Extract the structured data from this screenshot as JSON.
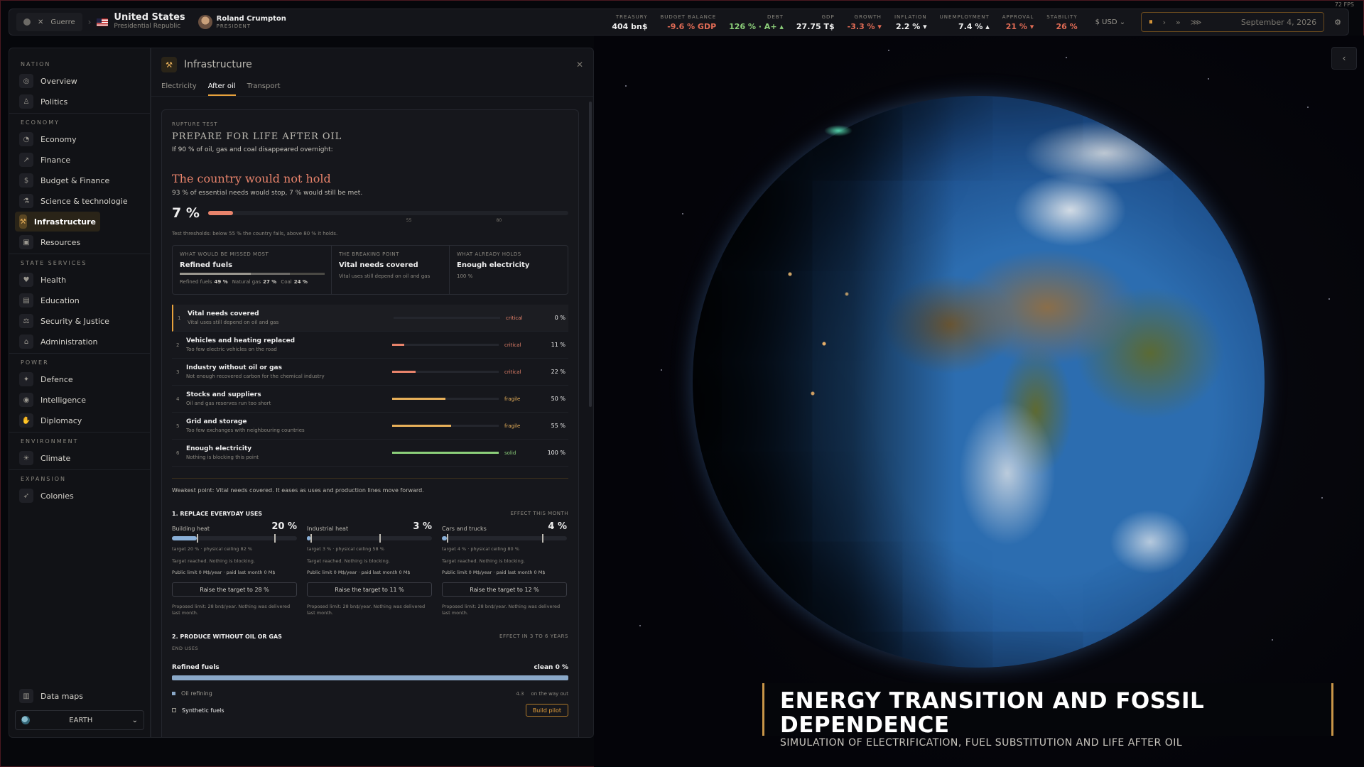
{
  "topbar": {
    "war_label": "Guerre",
    "country": "United States",
    "regime": "Presidential Republic",
    "leader": "Roland Crumpton",
    "leader_role": "PRESIDENT",
    "stats": [
      {
        "label": "TREASURY",
        "value": "404 bn$",
        "tone": ""
      },
      {
        "label": "BUDGET BALANCE",
        "value": "-9.6 % GDP",
        "tone": "neg"
      },
      {
        "label": "DEBT",
        "value": "126 % · A+ ▴",
        "tone": "pos"
      },
      {
        "label": "GDP",
        "value": "27.75 T$",
        "tone": ""
      },
      {
        "label": "GROWTH",
        "value": "-3.3 % ▾",
        "tone": "neg"
      },
      {
        "label": "INFLATION",
        "value": "2.2 % ▾",
        "tone": ""
      },
      {
        "label": "UNEMPLOYMENT",
        "value": "7.4 % ▴",
        "tone": ""
      },
      {
        "label": "APPROVAL",
        "value": "21 % ▾",
        "tone": "neg"
      },
      {
        "label": "STABILITY",
        "value": "26 %",
        "tone": "neg"
      }
    ],
    "currency": "$ USD",
    "date": "September 4, 2026",
    "fps": "72 FPS"
  },
  "sidebar": {
    "sections": [
      {
        "title": "NATION",
        "items": [
          {
            "label": "Overview",
            "icon": "globe-icon",
            "glyph": "◎"
          },
          {
            "label": "Politics",
            "icon": "podium-icon",
            "glyph": "♙"
          }
        ]
      },
      {
        "title": "ECONOMY",
        "items": [
          {
            "label": "Economy",
            "icon": "pie-icon",
            "glyph": "◔"
          },
          {
            "label": "Finance",
            "icon": "chart-icon",
            "glyph": "↗"
          },
          {
            "label": "Budget & Finance",
            "icon": "moneybag-icon",
            "glyph": "$"
          },
          {
            "label": "Science & technologie",
            "icon": "flask-icon",
            "glyph": "⚗"
          },
          {
            "label": "Infrastructure",
            "icon": "crane-icon",
            "glyph": "⚒",
            "active": true
          },
          {
            "label": "Resources",
            "icon": "barrel-icon",
            "glyph": "▣"
          }
        ]
      },
      {
        "title": "STATE SERVICES",
        "items": [
          {
            "label": "Health",
            "icon": "heart-icon",
            "glyph": "♥"
          },
          {
            "label": "Education",
            "icon": "book-icon",
            "glyph": "▤"
          },
          {
            "label": "Security & Justice",
            "icon": "scales-icon",
            "glyph": "⚖"
          },
          {
            "label": "Administration",
            "icon": "building-icon",
            "glyph": "⌂"
          }
        ]
      },
      {
        "title": "POWER",
        "items": [
          {
            "label": "Defence",
            "icon": "tank-icon",
            "glyph": "✦"
          },
          {
            "label": "Intelligence",
            "icon": "spy-icon",
            "glyph": "◉"
          },
          {
            "label": "Diplomacy",
            "icon": "handshake-icon",
            "glyph": "✋"
          }
        ]
      },
      {
        "title": "ENVIRONMENT",
        "items": [
          {
            "label": "Climate",
            "icon": "thermometer-icon",
            "glyph": "☀"
          }
        ]
      },
      {
        "title": "EXPANSION",
        "items": [
          {
            "label": "Colonies",
            "icon": "rocket-icon",
            "glyph": "➶"
          }
        ]
      }
    ],
    "data_maps": "Data maps",
    "planet": "EARTH"
  },
  "panel": {
    "title": "Infrastructure",
    "tabs": [
      {
        "label": "Electricity"
      },
      {
        "label": "After oil",
        "active": true
      },
      {
        "label": "Transport"
      }
    ],
    "kicker": "RUPTURE TEST",
    "heading": "PREPARE FOR LIFE AFTER OIL",
    "intro": "If 90 % of oil, gas and coal disappeared overnight:",
    "verdict": "The country would not hold",
    "verdict_sub": "93 % of essential needs would stop, 7 % would still be met.",
    "score_label": "7 %",
    "score": 7,
    "tick_55": "55",
    "tick_80": "80",
    "thresholds": "Test thresholds: below 55 % the country fails, above 80 % it holds.",
    "summary": {
      "missed_k": "WHAT WOULD BE MISSED MOST",
      "missed_b": "Refined fuels",
      "mix": [
        {
          "label": "Refined fuels",
          "value": "49 %",
          "pct": 49,
          "color": "#9a978f"
        },
        {
          "label": "Natural gas",
          "value": "27 %",
          "pct": 27,
          "color": "#6c6a66"
        },
        {
          "label": "Coal",
          "value": "24 %",
          "pct": 24,
          "color": "#4a4944"
        }
      ],
      "break_k": "THE BREAKING POINT",
      "break_b": "Vital needs covered",
      "break_s": "Vital uses still depend on oil and gas",
      "holds_k": "WHAT ALREADY HOLDS",
      "holds_b": "Enough electricity",
      "holds_s": "100 %"
    },
    "rows": [
      {
        "n": "1",
        "title": "Vital needs covered",
        "desc": "Vital uses still depend on oil and gas",
        "status": "critical",
        "value": "0 %",
        "pct": 0,
        "color": "#e8836b"
      },
      {
        "n": "2",
        "title": "Vehicles and heating replaced",
        "desc": "Too few electric vehicles on the road",
        "status": "critical",
        "value": "11 %",
        "pct": 11,
        "color": "#e8836b"
      },
      {
        "n": "3",
        "title": "Industry without oil or gas",
        "desc": "Not enough recovered carbon for the chemical industry",
        "status": "critical",
        "value": "22 %",
        "pct": 22,
        "color": "#e8836b"
      },
      {
        "n": "4",
        "title": "Stocks and suppliers",
        "desc": "Oil and gas reserves run too short",
        "status": "fragile",
        "value": "50 %",
        "pct": 50,
        "color": "#e8b05a"
      },
      {
        "n": "5",
        "title": "Grid and storage",
        "desc": "Too few exchanges with neighbouring countries",
        "status": "fragile",
        "value": "55 %",
        "pct": 55,
        "color": "#e8b05a"
      },
      {
        "n": "6",
        "title": "Enough electricity",
        "desc": "Nothing is blocking this point",
        "status": "solid",
        "value": "100 %",
        "pct": 100,
        "color": "#8ccf7a"
      }
    ],
    "weakest": "Weakest point: Vital needs covered. It eases as uses and production lines move forward.",
    "s1_title": "1. REPLACE EVERYDAY USES",
    "s1_tag": "EFFECT THIS MONTH",
    "levers": [
      {
        "name": "Building heat",
        "value": "20 %",
        "pct": 20,
        "ceiling": 82,
        "line1": "target 20 % · physical ceiling 82 %",
        "line2": "Target reached. Nothing is blocking.",
        "line3": "Public limit 0 M$/year · paid last month 0 M$",
        "btn": "Raise the target to 28 %",
        "prop": "Proposed limit: 28 bn$/year. Nothing was delivered last month."
      },
      {
        "name": "Industrial heat",
        "value": "3 %",
        "pct": 3,
        "ceiling": 58,
        "line1": "target 3 % · physical ceiling 58 %",
        "line2": "Target reached. Nothing is blocking.",
        "line3": "Public limit 0 M$/year · paid last month 0 M$",
        "btn": "Raise the target to 11 %",
        "prop": "Proposed limit: 28 bn$/year. Nothing was delivered last month."
      },
      {
        "name": "Cars and trucks",
        "value": "4 %",
        "pct": 4,
        "ceiling": 80,
        "line1": "target 4 % · physical ceiling 80 %",
        "line2": "Target reached. Nothing is blocking.",
        "line3": "Public limit 0 M$/year · paid last month 0 M$",
        "btn": "Raise the target to 12 %",
        "prop": "Proposed limit: 28 bn$/year. Nothing was delivered last month."
      }
    ],
    "s2_title": "2. PRODUCE WITHOUT OIL OR GAS",
    "s2_tag": "EFFECT IN 3 TO 6 YEARS",
    "end_uses": "END USES",
    "refined": "Refined fuels",
    "refined_clean": "clean 0 %",
    "oil_refining": "Oil refining",
    "oil_refining_val": "4.3",
    "oil_refining_status": "on the way out",
    "synthetic": "Synthetic fuels",
    "build_pilot": "Build pilot"
  },
  "caption": {
    "title": "ENERGY TRANSITION AND FOSSIL DEPENDENCE",
    "subtitle": "SIMULATION OF ELECTRIFICATION, FUEL SUBSTITUTION AND LIFE AFTER OIL"
  },
  "ui": {
    "pause": "⏸",
    "play": "›",
    "fast": "»",
    "faster": "⋙",
    "close": "✕",
    "collapse": "‹",
    "settings": "⚙",
    "chev": "⌄"
  }
}
